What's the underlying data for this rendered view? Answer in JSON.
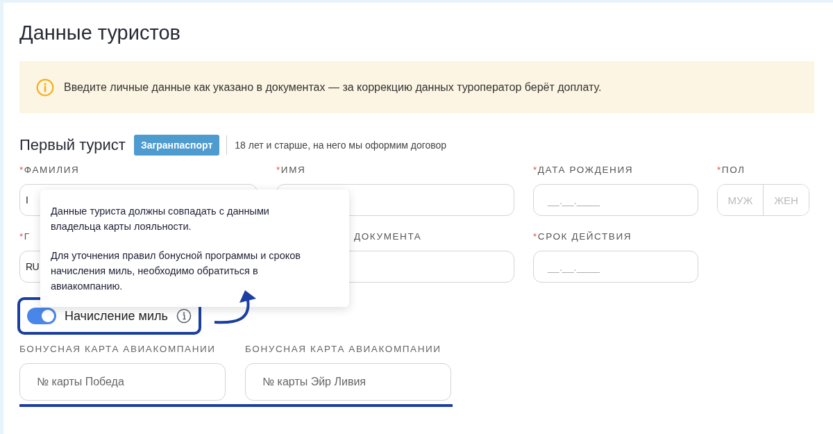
{
  "title": "Данные туристов",
  "notice": {
    "text": "Введите личные данные как указано в документах — за коррекцию данных туроператор берёт доплату."
  },
  "tourist": {
    "heading": "Первый турист",
    "badge": "Загранпаспорт",
    "note": "18 лет и старше, на него мы оформим договор"
  },
  "fields": [
    {
      "kind": "text",
      "label": "ФАМИЛИЯ",
      "required_mark": "*",
      "value": "I"
    },
    {
      "kind": "text",
      "label": "ИМЯ",
      "required_mark": "*"
    },
    {
      "kind": "date",
      "label": "ДАТА РОЖДЕНИЯ",
      "required_mark": "*",
      "placeholder": "__.__.____"
    },
    {
      "kind": "segment",
      "label": "ПОЛ",
      "required_mark": "*",
      "options": [
        {
          "label": "МУЖ",
          "selected": false
        },
        {
          "label": "ЖЕН",
          "selected": false
        }
      ]
    },
    {
      "kind": "text",
      "label": "Г",
      "required_mark": "*",
      "value": "RU"
    },
    {
      "kind": "text",
      "label": "ДОКУМЕНТА"
    },
    {
      "kind": "date",
      "label": "СРОК ДЕЙСТВИЯ",
      "required_mark": "*",
      "placeholder": "__.__.____"
    }
  ],
  "tooltip": {
    "paragraphs": [
      "Данные туриста должны совпадать с данными владельца карты лояльности.",
      "Для уточнения правил бонусной программы и сроков начисления миль, необходимо обратиться в авиакомпанию."
    ]
  },
  "miles_toggle": {
    "label": "Начисление миль",
    "on": true
  },
  "cards": [
    {
      "label": "БОНУСНАЯ КАРТА АВИАКОМПАНИИ",
      "placeholder": "№ карты Победа"
    },
    {
      "label": "БОНУСНАЯ КАРТА АВИАКОМПАНИИ",
      "placeholder": "№ карты Эйр Ливия"
    }
  ]
}
